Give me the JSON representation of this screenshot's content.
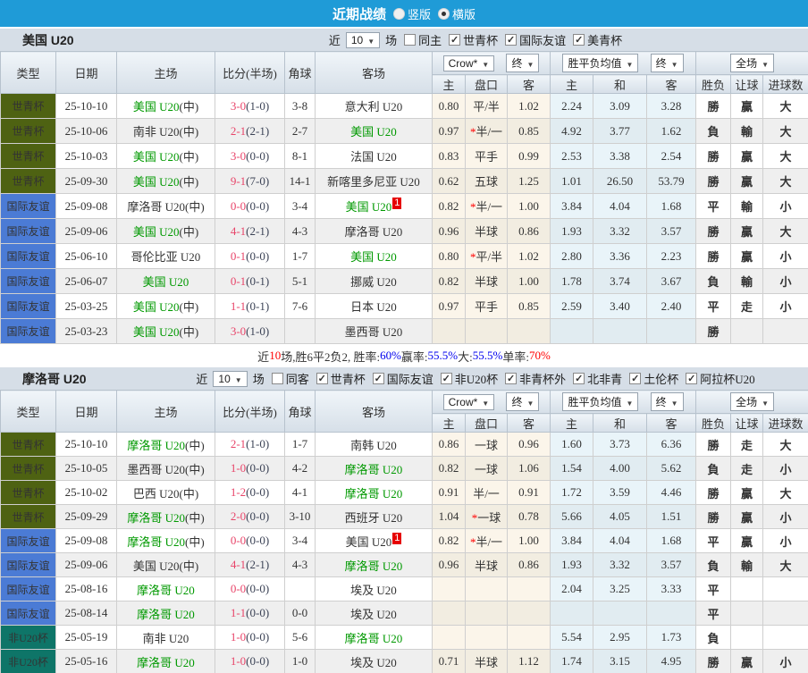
{
  "topbar": {
    "title": "近期战绩",
    "radio_vertical": "竖版",
    "radio_horizontal": "横版"
  },
  "table_header": {
    "cols": [
      "类型",
      "日期",
      "主场",
      "比分(半场)",
      "角球",
      "客场"
    ],
    "selects": [
      "Crow*",
      "终",
      "胜平负均值",
      "终",
      "全场"
    ],
    "subcols": [
      "主",
      "盘口",
      "客",
      "主",
      "和",
      "客",
      "胜负",
      "让球",
      "进球数"
    ]
  },
  "type_colors": {
    "世青杯": "#4e6212",
    "国际友谊": "#4b7bd5",
    "非U20杯": "#0e7568"
  },
  "result_colors": {
    "勝": "red",
    "贏": "red",
    "大": "red",
    "負": "green",
    "輸": "green",
    "小": "green",
    "平": "blue",
    "走": "blue"
  },
  "colors": {
    "topbar": "#1f9bd7",
    "section_bar": "#d6dee7",
    "score_red": "#e8456a",
    "team_green": "#009900",
    "odds_col_bg": "#fbf5ea",
    "avg_col_bg": "#e9f4f9"
  },
  "sections": [
    {
      "team": "美国 U20",
      "near_label": "近",
      "near_value": "10",
      "unit_label": "场",
      "filters": [
        {
          "label": "同主",
          "checked": false
        },
        {
          "label": "世青杯",
          "checked": true
        },
        {
          "label": "国际友谊",
          "checked": true
        },
        {
          "label": "美青杯",
          "checked": true
        }
      ],
      "rows": [
        {
          "type": "世青杯",
          "date": "25-10-10",
          "home": "美国 U20",
          "home_green": true,
          "home_mid": true,
          "ft": "3-0",
          "ht": "(1-0)",
          "corner": "3-8",
          "away": "意大利 U20",
          "away_green": false,
          "badge": "",
          "odds_home": "0.80",
          "handicap": "平/半",
          "handicap_star": false,
          "odds_away": "1.02",
          "avg_home": "2.24",
          "avg_draw": "3.09",
          "avg_away": "3.28",
          "wdl": "勝",
          "handicap_result": "贏",
          "goals_result": "大"
        },
        {
          "type": "世青杯",
          "date": "25-10-06",
          "home": "南非 U20",
          "home_green": false,
          "home_mid": true,
          "ft": "2-1",
          "ht": "(2-1)",
          "corner": "2-7",
          "away": "美国 U20",
          "away_green": true,
          "badge": "",
          "odds_home": "0.97",
          "handicap": "半/一",
          "handicap_star": true,
          "odds_away": "0.85",
          "avg_home": "4.92",
          "avg_draw": "3.77",
          "avg_away": "1.62",
          "wdl": "負",
          "handicap_result": "輸",
          "goals_result": "大"
        },
        {
          "type": "世青杯",
          "date": "25-10-03",
          "home": "美国 U20",
          "home_green": true,
          "home_mid": true,
          "ft": "3-0",
          "ht": "(0-0)",
          "corner": "8-1",
          "away": "法国 U20",
          "away_green": false,
          "badge": "",
          "odds_home": "0.83",
          "handicap": "平手",
          "handicap_star": false,
          "odds_away": "0.99",
          "avg_home": "2.53",
          "avg_draw": "3.38",
          "avg_away": "2.54",
          "wdl": "勝",
          "handicap_result": "贏",
          "goals_result": "大"
        },
        {
          "type": "世青杯",
          "date": "25-09-30",
          "home": "美国 U20",
          "home_green": true,
          "home_mid": true,
          "ft": "9-1",
          "ht": "(7-0)",
          "corner": "14-1",
          "away": "新喀里多尼亚 U20",
          "away_green": false,
          "badge": "",
          "odds_home": "0.62",
          "handicap": "五球",
          "handicap_star": false,
          "odds_away": "1.25",
          "avg_home": "1.01",
          "avg_draw": "26.50",
          "avg_away": "53.79",
          "wdl": "勝",
          "handicap_result": "贏",
          "goals_result": "大"
        },
        {
          "type": "国际友谊",
          "date": "25-09-08",
          "home": "摩洛哥 U20",
          "home_green": false,
          "home_mid": true,
          "ft": "0-0",
          "ht": "(0-0)",
          "corner": "3-4",
          "away": "美国 U20",
          "away_green": true,
          "badge": "1",
          "odds_home": "0.82",
          "handicap": "半/一",
          "handicap_star": true,
          "odds_away": "1.00",
          "avg_home": "3.84",
          "avg_draw": "4.04",
          "avg_away": "1.68",
          "wdl": "平",
          "handicap_result": "輸",
          "goals_result": "小"
        },
        {
          "type": "国际友谊",
          "date": "25-09-06",
          "home": "美国 U20",
          "home_green": true,
          "home_mid": true,
          "ft": "4-1",
          "ht": "(2-1)",
          "corner": "4-3",
          "away": "摩洛哥 U20",
          "away_green": false,
          "badge": "",
          "odds_home": "0.96",
          "handicap": "半球",
          "handicap_star": false,
          "odds_away": "0.86",
          "avg_home": "1.93",
          "avg_draw": "3.32",
          "avg_away": "3.57",
          "wdl": "勝",
          "handicap_result": "贏",
          "goals_result": "大"
        },
        {
          "type": "国际友谊",
          "date": "25-06-10",
          "home": "哥伦比亚 U20",
          "home_green": false,
          "home_mid": false,
          "ft": "0-1",
          "ht": "(0-0)",
          "corner": "1-7",
          "away": "美国 U20",
          "away_green": true,
          "badge": "",
          "odds_home": "0.80",
          "handicap": "平/半",
          "handicap_star": true,
          "odds_away": "1.02",
          "avg_home": "2.80",
          "avg_draw": "3.36",
          "avg_away": "2.23",
          "wdl": "勝",
          "handicap_result": "贏",
          "goals_result": "小"
        },
        {
          "type": "国际友谊",
          "date": "25-06-07",
          "home": "美国 U20",
          "home_green": true,
          "home_mid": false,
          "ft": "0-1",
          "ht": "(0-1)",
          "corner": "5-1",
          "away": "挪威 U20",
          "away_green": false,
          "badge": "",
          "odds_home": "0.82",
          "handicap": "半球",
          "handicap_star": false,
          "odds_away": "1.00",
          "avg_home": "1.78",
          "avg_draw": "3.74",
          "avg_away": "3.67",
          "wdl": "負",
          "handicap_result": "輸",
          "goals_result": "小"
        },
        {
          "type": "国际友谊",
          "date": "25-03-25",
          "home": "美国 U20",
          "home_green": true,
          "home_mid": true,
          "ft": "1-1",
          "ht": "(0-1)",
          "corner": "7-6",
          "away": "日本 U20",
          "away_green": false,
          "badge": "",
          "odds_home": "0.97",
          "handicap": "平手",
          "handicap_star": false,
          "odds_away": "0.85",
          "avg_home": "2.59",
          "avg_draw": "3.40",
          "avg_away": "2.40",
          "wdl": "平",
          "handicap_result": "走",
          "goals_result": "小"
        },
        {
          "type": "国际友谊",
          "date": "25-03-23",
          "home": "美国 U20",
          "home_green": true,
          "home_mid": true,
          "ft": "3-0",
          "ht": "(1-0)",
          "corner": "",
          "away": "墨西哥 U20",
          "away_green": false,
          "badge": "",
          "odds_home": "",
          "handicap": "",
          "handicap_star": false,
          "odds_away": "",
          "avg_home": "",
          "avg_draw": "",
          "avg_away": "",
          "wdl": "勝",
          "handicap_result": "",
          "goals_result": ""
        }
      ],
      "summary": [
        {
          "text": "近",
          "color": "dark"
        },
        {
          "text": "10",
          "color": "red"
        },
        {
          "text": "场,胜6平2负2, 胜率:",
          "color": "dark"
        },
        {
          "text": "60%",
          "color": "blue"
        },
        {
          "text": " 赢率:",
          "color": "dark"
        },
        {
          "text": "55.5%",
          "color": "blue"
        },
        {
          "text": " 大:",
          "color": "dark"
        },
        {
          "text": "55.5%",
          "color": "blue"
        },
        {
          "text": " 单率:",
          "color": "dark"
        },
        {
          "text": "70%",
          "color": "red"
        }
      ]
    },
    {
      "team": "摩洛哥 U20",
      "near_label": "近",
      "near_value": "10",
      "unit_label": "场",
      "filters": [
        {
          "label": "同客",
          "checked": false
        },
        {
          "label": "世青杯",
          "checked": true
        },
        {
          "label": "国际友谊",
          "checked": true
        },
        {
          "label": "非U20杯",
          "checked": true
        },
        {
          "label": "非青杯外",
          "checked": true
        },
        {
          "label": "北非青",
          "checked": true
        },
        {
          "label": "土伦杯",
          "checked": true
        },
        {
          "label": "阿拉杯U20",
          "checked": true
        }
      ],
      "rows": [
        {
          "type": "世青杯",
          "date": "25-10-10",
          "home": "摩洛哥 U20",
          "home_green": true,
          "home_mid": true,
          "ft": "2-1",
          "ht": "(1-0)",
          "corner": "1-7",
          "away": "南韩 U20",
          "away_green": false,
          "badge": "",
          "odds_home": "0.86",
          "handicap": "一球",
          "handicap_star": false,
          "odds_away": "0.96",
          "avg_home": "1.60",
          "avg_draw": "3.73",
          "avg_away": "6.36",
          "wdl": "勝",
          "handicap_result": "走",
          "goals_result": "大"
        },
        {
          "type": "世青杯",
          "date": "25-10-05",
          "home": "墨西哥 U20",
          "home_green": false,
          "home_mid": true,
          "ft": "1-0",
          "ht": "(0-0)",
          "corner": "4-2",
          "away": "摩洛哥 U20",
          "away_green": true,
          "badge": "",
          "odds_home": "0.82",
          "handicap": "一球",
          "handicap_star": false,
          "odds_away": "1.06",
          "avg_home": "1.54",
          "avg_draw": "4.00",
          "avg_away": "5.62",
          "wdl": "負",
          "handicap_result": "走",
          "goals_result": "小"
        },
        {
          "type": "世青杯",
          "date": "25-10-02",
          "home": "巴西 U20",
          "home_green": false,
          "home_mid": true,
          "ft": "1-2",
          "ht": "(0-0)",
          "corner": "4-1",
          "away": "摩洛哥 U20",
          "away_green": true,
          "badge": "",
          "odds_home": "0.91",
          "handicap": "半/一",
          "handicap_star": false,
          "odds_away": "0.91",
          "avg_home": "1.72",
          "avg_draw": "3.59",
          "avg_away": "4.46",
          "wdl": "勝",
          "handicap_result": "贏",
          "goals_result": "大"
        },
        {
          "type": "世青杯",
          "date": "25-09-29",
          "home": "摩洛哥 U20",
          "home_green": true,
          "home_mid": true,
          "ft": "2-0",
          "ht": "(0-0)",
          "corner": "3-10",
          "away": "西班牙 U20",
          "away_green": false,
          "badge": "",
          "odds_home": "1.04",
          "handicap": "一球",
          "handicap_star": true,
          "odds_away": "0.78",
          "avg_home": "5.66",
          "avg_draw": "4.05",
          "avg_away": "1.51",
          "wdl": "勝",
          "handicap_result": "贏",
          "goals_result": "小"
        },
        {
          "type": "国际友谊",
          "date": "25-09-08",
          "home": "摩洛哥 U20",
          "home_green": true,
          "home_mid": true,
          "ft": "0-0",
          "ht": "(0-0)",
          "corner": "3-4",
          "away": "美国 U20",
          "away_green": false,
          "badge": "1",
          "odds_home": "0.82",
          "handicap": "半/一",
          "handicap_star": true,
          "odds_away": "1.00",
          "avg_home": "3.84",
          "avg_draw": "4.04",
          "avg_away": "1.68",
          "wdl": "平",
          "handicap_result": "贏",
          "goals_result": "小"
        },
        {
          "type": "国际友谊",
          "date": "25-09-06",
          "home": "美国 U20",
          "home_green": false,
          "home_mid": true,
          "ft": "4-1",
          "ht": "(2-1)",
          "corner": "4-3",
          "away": "摩洛哥 U20",
          "away_green": true,
          "badge": "",
          "odds_home": "0.96",
          "handicap": "半球",
          "handicap_star": false,
          "odds_away": "0.86",
          "avg_home": "1.93",
          "avg_draw": "3.32",
          "avg_away": "3.57",
          "wdl": "負",
          "handicap_result": "輸",
          "goals_result": "大"
        },
        {
          "type": "国际友谊",
          "date": "25-08-16",
          "home": "摩洛哥 U20",
          "home_green": true,
          "home_mid": false,
          "ft": "0-0",
          "ht": "(0-0)",
          "corner": "",
          "away": "埃及 U20",
          "away_green": false,
          "badge": "",
          "odds_home": "",
          "handicap": "",
          "handicap_star": false,
          "odds_away": "",
          "avg_home": "2.04",
          "avg_draw": "3.25",
          "avg_away": "3.33",
          "wdl": "平",
          "handicap_result": "",
          "goals_result": ""
        },
        {
          "type": "国际友谊",
          "date": "25-08-14",
          "home": "摩洛哥 U20",
          "home_green": true,
          "home_mid": false,
          "ft": "1-1",
          "ht": "(0-0)",
          "corner": "0-0",
          "away": "埃及 U20",
          "away_green": false,
          "badge": "",
          "odds_home": "",
          "handicap": "",
          "handicap_star": false,
          "odds_away": "",
          "avg_home": "",
          "avg_draw": "",
          "avg_away": "",
          "wdl": "平",
          "handicap_result": "",
          "goals_result": ""
        },
        {
          "type": "非U20杯",
          "date": "25-05-19",
          "home": "南非 U20",
          "home_green": false,
          "home_mid": false,
          "ft": "1-0",
          "ht": "(0-0)",
          "corner": "5-6",
          "away": "摩洛哥 U20",
          "away_green": true,
          "badge": "",
          "odds_home": "",
          "handicap": "",
          "handicap_star": false,
          "odds_away": "",
          "avg_home": "5.54",
          "avg_draw": "2.95",
          "avg_away": "1.73",
          "wdl": "負",
          "handicap_result": "",
          "goals_result": ""
        },
        {
          "type": "非U20杯",
          "date": "25-05-16",
          "home": "摩洛哥 U20",
          "home_green": true,
          "home_mid": false,
          "ft": "1-0",
          "ht": "(0-0)",
          "corner": "1-0",
          "away": "埃及 U20",
          "away_green": false,
          "badge": "",
          "odds_home": "0.71",
          "handicap": "半球",
          "handicap_star": false,
          "odds_away": "1.12",
          "avg_home": "1.74",
          "avg_draw": "3.15",
          "avg_away": "4.95",
          "wdl": "勝",
          "handicap_result": "贏",
          "goals_result": "小"
        }
      ],
      "summary": null
    }
  ]
}
